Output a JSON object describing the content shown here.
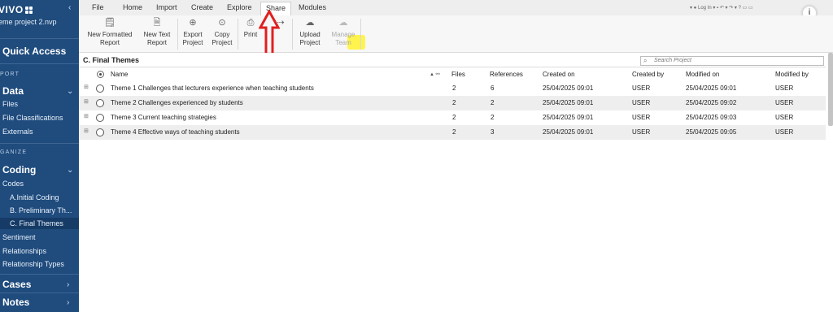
{
  "sidebar": {
    "logo_text": "VIVO",
    "project_name": "eme project 2.nvp",
    "quick_access": "Quick Access",
    "section_import": "PORT",
    "data": {
      "title": "Data",
      "items": [
        "Files",
        "File Classifications",
        "Externals"
      ]
    },
    "section_organize": "GANIZE",
    "coding": {
      "title": "Coding",
      "codes_label": "Codes",
      "code_folders": [
        "A.Initial Coding",
        "B. Preliminary Th...",
        "C. Final Themes"
      ],
      "items": [
        "Sentiment",
        "Relationships",
        "Relationship Types"
      ]
    },
    "cases": "Cases",
    "notes": "Notes"
  },
  "tabs": [
    "File",
    "Home",
    "Import",
    "Create",
    "Explore",
    "Share",
    "Modules"
  ],
  "active_tab": "Share",
  "titlebar": {
    "login": "Log In"
  },
  "ribbon": {
    "new_formatted_report": [
      "New Formatted",
      "Report"
    ],
    "new_text_report": [
      "New Text",
      "Report"
    ],
    "export_project": [
      "Export",
      "Project"
    ],
    "copy_project": [
      "Copy",
      "Project"
    ],
    "print": "Print",
    "upload_project": [
      "Upload",
      "Project"
    ],
    "manage_team": [
      "Manage",
      "Team"
    ]
  },
  "content": {
    "folder_title": "C. Final Themes",
    "search_placeholder": "Search Project",
    "columns": {
      "name": "Name",
      "files": "Files",
      "references": "References",
      "created_on": "Created on",
      "created_by": "Created by",
      "modified_on": "Modified on",
      "modified_by": "Modified by"
    },
    "rows": [
      {
        "name": "Theme 1 Challenges that lecturers experience when teaching students",
        "files": "2",
        "references": "6",
        "created_on": "25/04/2025 09:01",
        "created_by": "USER",
        "modified_on": "25/04/2025 09:01",
        "modified_by": "USER"
      },
      {
        "name": "Theme 2 Challenges experienced by students",
        "files": "2",
        "references": "2",
        "created_on": "25/04/2025 09:01",
        "created_by": "USER",
        "modified_on": "25/04/2025 09:02",
        "modified_by": "USER"
      },
      {
        "name": "Theme 3 Current teaching strategies",
        "files": "2",
        "references": "2",
        "created_on": "25/04/2025 09:01",
        "created_by": "USER",
        "modified_on": "25/04/2025 09:03",
        "modified_by": "USER"
      },
      {
        "name": "Theme 4 Effective ways of teaching students",
        "files": "2",
        "references": "3",
        "created_on": "25/04/2025 09:01",
        "created_by": "USER",
        "modified_on": "25/04/2025 09:05",
        "modified_by": "USER"
      }
    ]
  },
  "colors": {
    "sidebar_bg": "#1f4b7d",
    "highlight": "#fff23a",
    "arrow": "#e02020"
  }
}
